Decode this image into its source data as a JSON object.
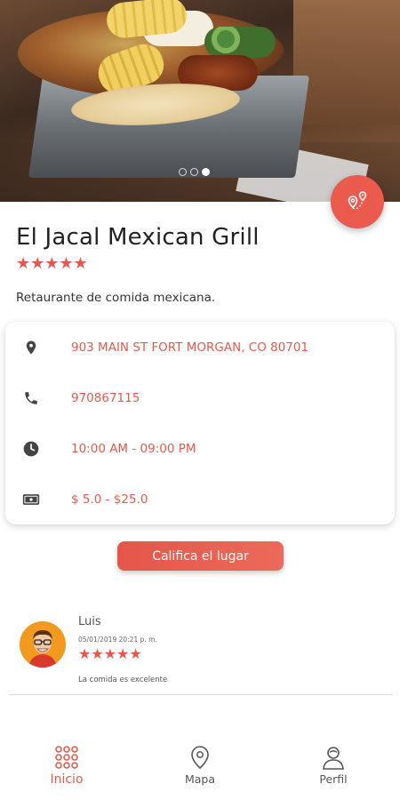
{
  "hero": {
    "carousel_count": 3,
    "carousel_active": 3
  },
  "restaurant": {
    "name": "El Jacal Mexican Grill",
    "rating_stars": "★★★★★",
    "description": "Retaurante de comida mexicana."
  },
  "info": {
    "address": "903 MAIN ST FORT MORGAN, CO 80701",
    "phone": "970867115",
    "hours": "10:00 AM - 09:00 PM",
    "price": "$ 5.0 - $25.0"
  },
  "actions": {
    "rate_label": "Califica el lugar"
  },
  "review": {
    "author": "Luis",
    "date": "05/01/2019 20:21 p. m.",
    "stars": "★★★★★",
    "comment": "La comida es excelente"
  },
  "nav": {
    "items": [
      {
        "label": "Inicio",
        "icon": "grid-icon",
        "active": true
      },
      {
        "label": "Mapa",
        "icon": "map-pin-icon",
        "active": false
      },
      {
        "label": "Perfil",
        "icon": "user-icon",
        "active": false
      }
    ]
  },
  "colors": {
    "accent": "#e35a4b",
    "fab": "#ea5b4d"
  }
}
